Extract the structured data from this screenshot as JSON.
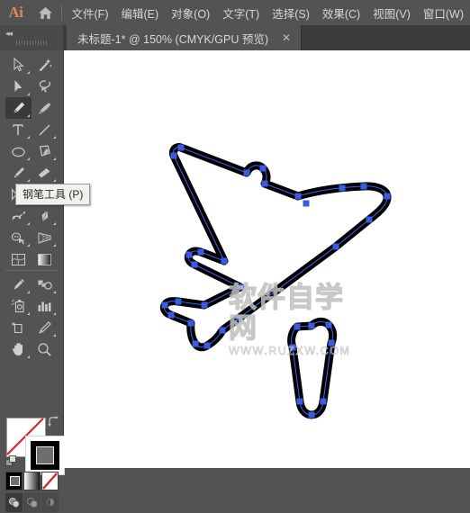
{
  "app": {
    "name": "Ai",
    "brand_color": "#e0855a",
    "chrome_bg": "#535353",
    "tabbar_bg": "#3b3b3b",
    "anchor_color": "#3b5ce0",
    "path_color": "#000000"
  },
  "menubar": {
    "logo": "Ai",
    "home_icon": "home-icon",
    "items": [
      {
        "label": "文件(F)"
      },
      {
        "label": "编辑(E)"
      },
      {
        "label": "对象(O)"
      },
      {
        "label": "文字(T)"
      },
      {
        "label": "选择(S)"
      },
      {
        "label": "效果(C)"
      },
      {
        "label": "视图(V)"
      },
      {
        "label": "窗口(W)"
      }
    ]
  },
  "tabbar": {
    "collapse_icon": "double-chevron-left-icon",
    "grip_icon": "drag-grip-icon",
    "document": {
      "title": "未标题-1* @ 150% (CMYK/GPU 预览)",
      "close_label": "✕"
    }
  },
  "toolbar": {
    "tooltip": "钢笔工具 (P)",
    "selected_tool": "pen-tool",
    "tools": [
      {
        "name": "selection-tool",
        "has_flyout": true
      },
      {
        "name": "magic-wand-tool",
        "has_flyout": false
      },
      {
        "name": "direct-selection-tool",
        "has_flyout": true
      },
      {
        "name": "lasso-tool",
        "has_flyout": false
      },
      {
        "name": "pen-tool",
        "has_flyout": true
      },
      {
        "name": "curvature-tool",
        "has_flyout": false
      },
      {
        "name": "type-tool",
        "has_flyout": true
      },
      {
        "name": "line-segment-tool",
        "has_flyout": true
      },
      {
        "name": "ellipse-tool",
        "has_flyout": true
      },
      {
        "name": "shaper-tool",
        "has_flyout": true
      },
      {
        "name": "paintbrush-tool",
        "has_flyout": true
      },
      {
        "name": "eraser-tool",
        "has_flyout": true
      },
      {
        "name": "rotate-tool",
        "has_flyout": true
      },
      {
        "name": "scale-tool",
        "has_flyout": true
      },
      {
        "name": "width-tool",
        "has_flyout": true
      },
      {
        "name": "free-transform-tool",
        "has_flyout": true
      },
      {
        "name": "shape-builder-tool",
        "has_flyout": true
      },
      {
        "name": "perspective-grid-tool",
        "has_flyout": true
      },
      {
        "name": "mesh-tool",
        "has_flyout": false
      },
      {
        "name": "gradient-tool",
        "has_flyout": false
      },
      {
        "name": "eyedropper-tool",
        "has_flyout": true
      },
      {
        "name": "blend-tool",
        "has_flyout": true
      },
      {
        "name": "symbol-sprayer-tool",
        "has_flyout": true
      },
      {
        "name": "column-graph-tool",
        "has_flyout": true
      },
      {
        "name": "artboard-tool",
        "has_flyout": false
      },
      {
        "name": "slice-tool",
        "has_flyout": true
      },
      {
        "name": "hand-tool",
        "has_flyout": true
      },
      {
        "name": "zoom-tool",
        "has_flyout": false
      }
    ]
  },
  "color_controls": {
    "fill": {
      "name": "fill-swatch",
      "value": "none"
    },
    "stroke": {
      "name": "stroke-swatch",
      "value": "#000000"
    },
    "swap_icon": "swap-fill-stroke-icon",
    "default_icon": "default-fill-stroke-icon",
    "modes": [
      {
        "name": "color-mode-button",
        "selected": true
      },
      {
        "name": "gradient-mode-button",
        "selected": false
      },
      {
        "name": "none-mode-button",
        "selected": false
      }
    ],
    "draw_modes": [
      {
        "name": "draw-normal-button",
        "selected": true
      },
      {
        "name": "draw-behind-button",
        "selected": false
      },
      {
        "name": "draw-inside-button",
        "selected": false
      }
    ]
  },
  "canvas": {
    "zoom_level": "150%",
    "artwork_name": "airplane-path",
    "watermark": {
      "main": "软件自学网",
      "sub": "WWW.RUZXW.COM"
    }
  }
}
